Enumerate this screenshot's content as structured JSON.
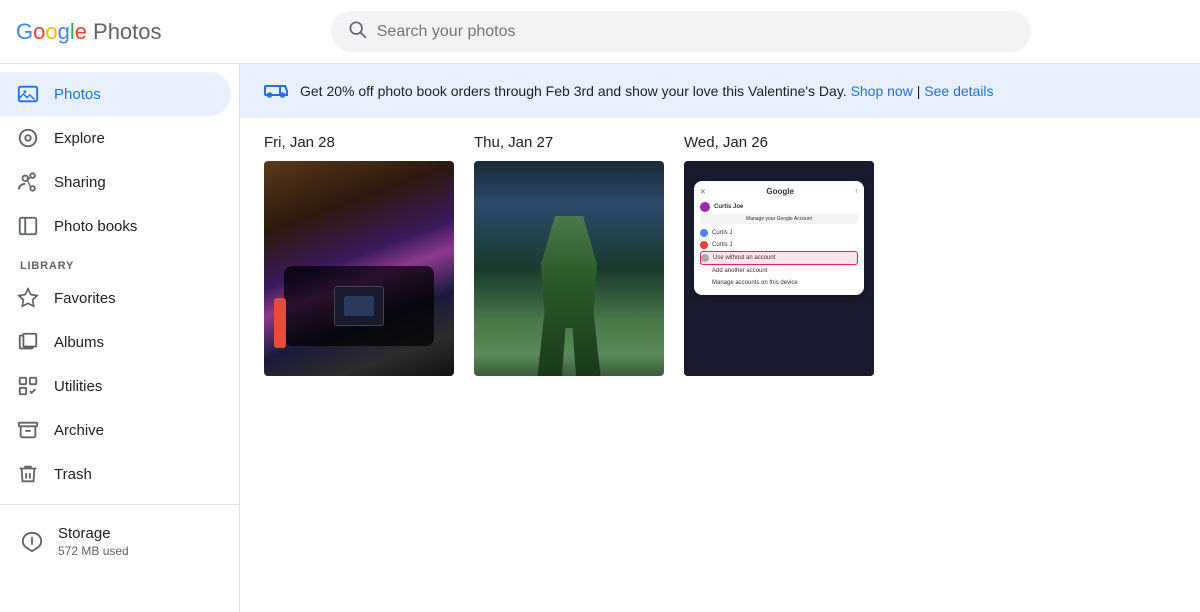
{
  "header": {
    "logo_google": "Google",
    "logo_photos": "Photos",
    "search_placeholder": "Search your photos"
  },
  "sidebar": {
    "nav_items": [
      {
        "id": "photos",
        "label": "Photos",
        "icon": "photos",
        "active": true
      },
      {
        "id": "explore",
        "label": "Explore",
        "icon": "explore",
        "active": false
      },
      {
        "id": "sharing",
        "label": "Sharing",
        "icon": "sharing",
        "active": false
      },
      {
        "id": "photo-books",
        "label": "Photo books",
        "icon": "book",
        "active": false
      }
    ],
    "library_label": "LIBRARY",
    "library_items": [
      {
        "id": "favorites",
        "label": "Favorites",
        "icon": "star"
      },
      {
        "id": "albums",
        "label": "Albums",
        "icon": "album"
      },
      {
        "id": "utilities",
        "label": "Utilities",
        "icon": "utilities"
      },
      {
        "id": "archive",
        "label": "Archive",
        "icon": "archive"
      },
      {
        "id": "trash",
        "label": "Trash",
        "icon": "trash"
      }
    ],
    "storage_label": "Storage",
    "storage_used": "572 MB used"
  },
  "promo": {
    "text": "Get 20% off photo book orders through Feb 3rd and show your love this Valentine's Day.",
    "shop_now": "Shop now",
    "separator": "|",
    "see_details": "See details"
  },
  "photos": {
    "sections": [
      {
        "date": "Fri, Jan 28",
        "count": 1
      },
      {
        "date": "Thu, Jan 27",
        "count": 1
      },
      {
        "date": "Wed, Jan 26",
        "count": 1
      }
    ]
  },
  "mini_modal": {
    "title": "Google",
    "user_name": "Curtis Joe",
    "manage_label": "Manage your Google Account",
    "account1": "Curtis J",
    "account2": "Curtis J",
    "use_without": "Use without an account",
    "add_account": "Add another account",
    "manage_devices": "Manage accounts on this device"
  },
  "colors": {
    "accent": "#1a73e8",
    "active_bg": "#e8f0fe",
    "promo_bg": "#e8f0fe"
  }
}
